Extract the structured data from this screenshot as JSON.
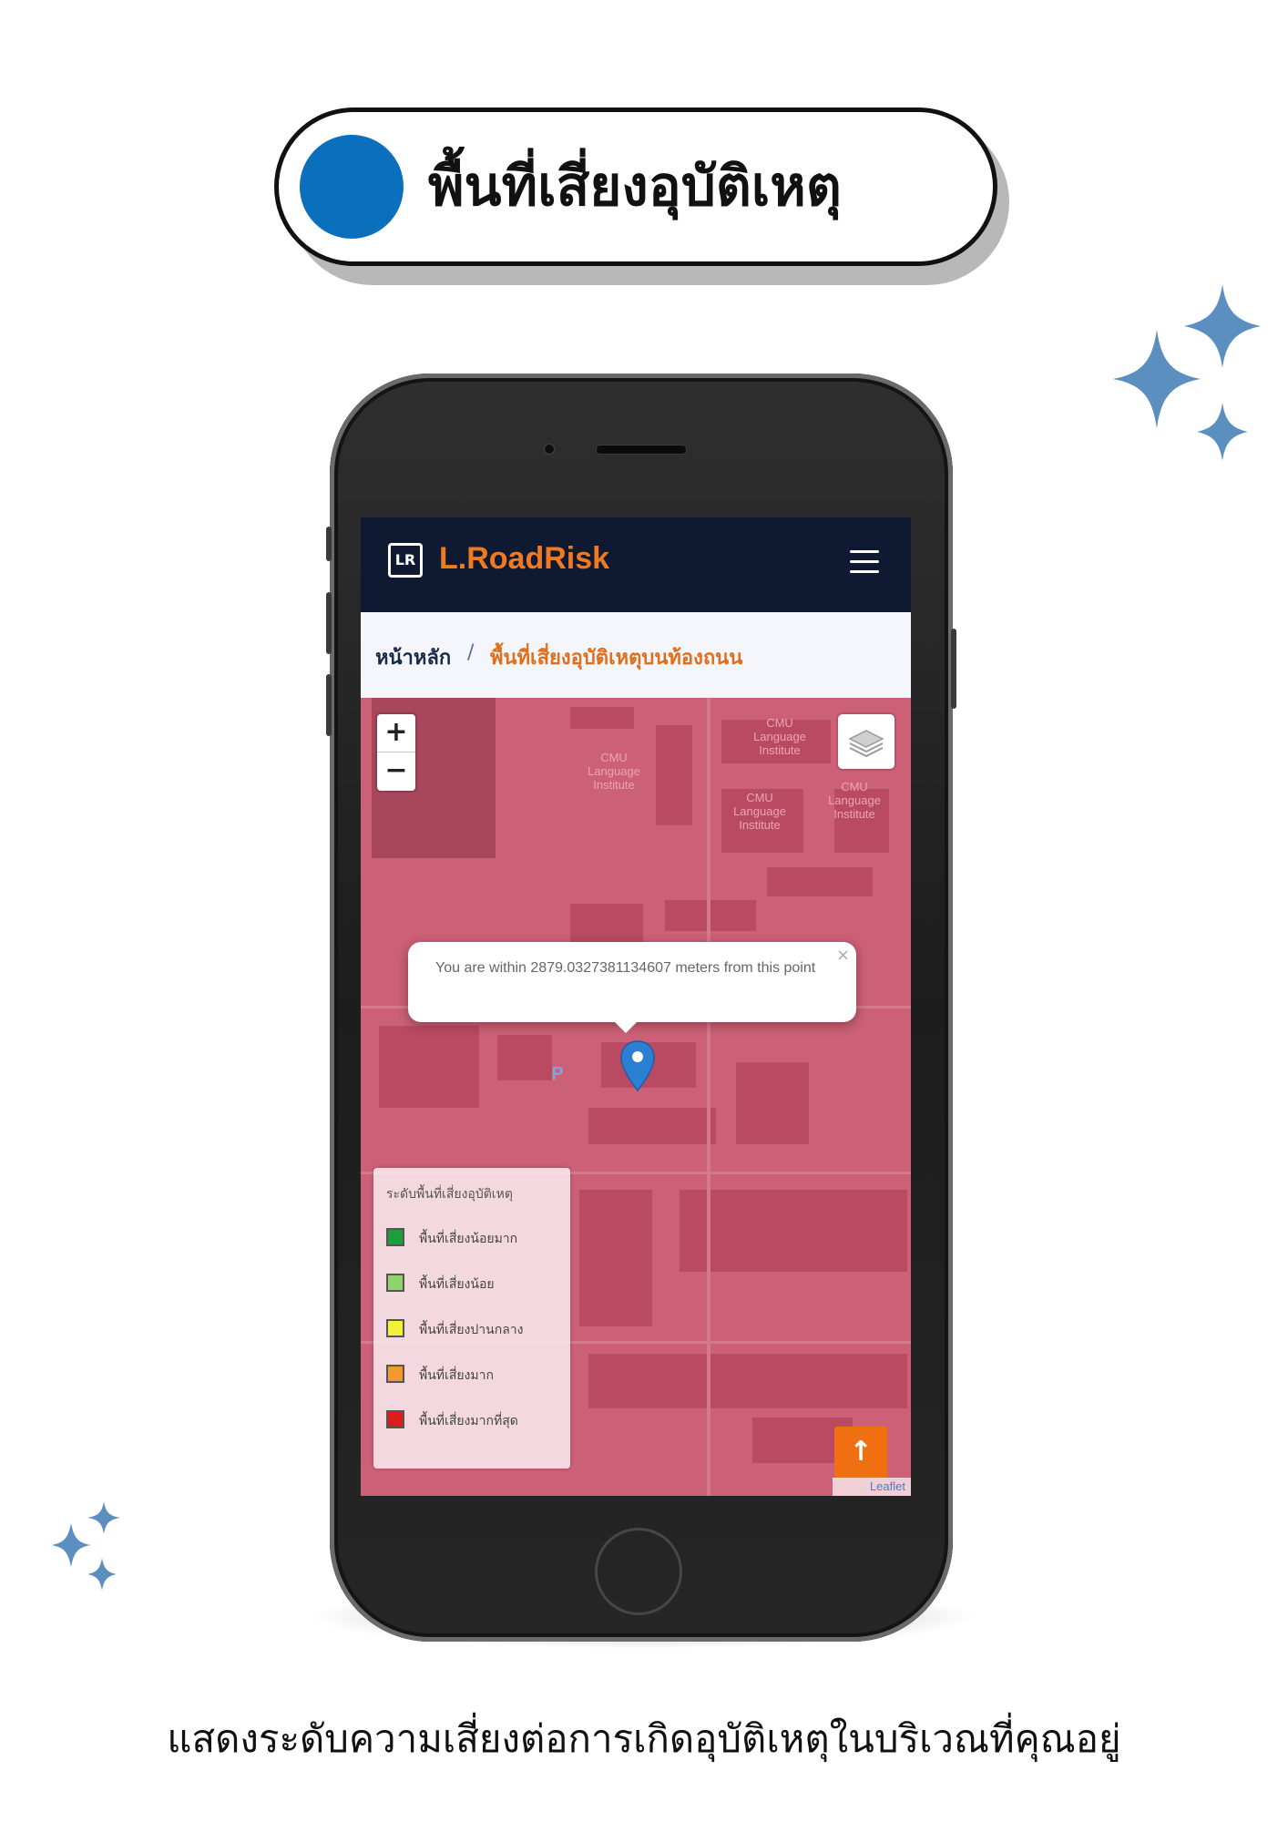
{
  "header": {
    "title": "พื้นที่เสี่ยงอุบัติเหตุ"
  },
  "app": {
    "logo_text": "LR",
    "brand": "L.RoadRisk",
    "menu_icon": "hamburger-menu-icon"
  },
  "breadcrumb": {
    "home": "หน้าหลัก",
    "separator": "/",
    "current": "พื้นที่เสี่ยงอุบัติเหตุบนท้องถนน"
  },
  "map": {
    "zoom_in": "+",
    "zoom_out": "−",
    "layers_icon": "layers-icon",
    "popup_text": "You are within 2879.0327381134607 meters from this point",
    "popup_close": "×",
    "marker_icon": "map-pin-icon",
    "labels": {
      "l1": "CMU\nLanguage\nInstitute",
      "l2": "CMU\nLanguage\nInstitute",
      "l3": "CMU\nLanguage\nInstitute",
      "l4": "CMU\nLanguage\nInstitute",
      "p": "P"
    },
    "attribution": "Leaflet",
    "back_to_top": "↑"
  },
  "legend": {
    "title": "ระดับพื้นที่เสี่ยงอุบัติเหตุ",
    "items": [
      {
        "label": "พื้นที่เสี่ยงน้อยมาก",
        "color": "#1e9e3a"
      },
      {
        "label": "พื้นที่เสี่ยงน้อย",
        "color": "#8fd36a"
      },
      {
        "label": "พื้นที่เสี่ยงปานกลาง",
        "color": "#f2f23a"
      },
      {
        "label": "พื้นที่เสี่ยงมาก",
        "color": "#f29a2e"
      },
      {
        "label": "พื้นที่เสี่ยงมากที่สุด",
        "color": "#e01b1b"
      }
    ]
  },
  "colors": {
    "accent_blue": "#0a70bd",
    "brand_orange": "#f07a1f",
    "navbar": "#0f1a32",
    "map_overlay": "#cc6076",
    "sparkle": "#5b8fc0"
  },
  "caption": "แสดงระดับความเสี่ยงต่อการเกิดอุบัติเหตุในบริเวณที่คุณอยู่"
}
